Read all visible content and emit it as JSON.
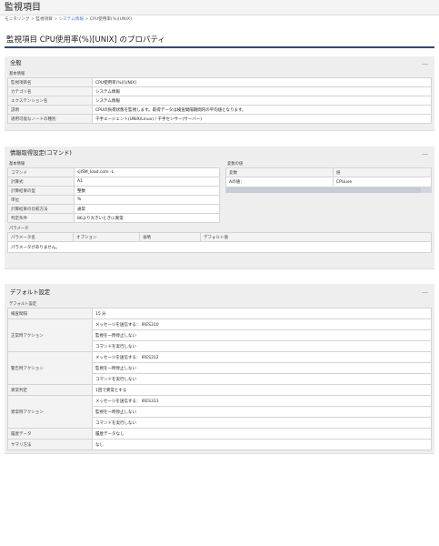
{
  "app": {
    "title": "監視項目"
  },
  "breadcrumb": {
    "item1": "モニタリング",
    "item2": "監視項目",
    "item3": "システム情報",
    "item4": "CPU使用率(%)[UNIX]",
    "sep": ">"
  },
  "page_title": "監視項目 CPU使用率(%)[UNIX] のプロパティ",
  "general": {
    "title": "全般",
    "collapse": "—",
    "sub": "基本情報",
    "rows": [
      {
        "label": "監視項目名",
        "value": "CPU使用率(%)[UNIX]"
      },
      {
        "label": "カテゴリ名",
        "value": "システム情報"
      },
      {
        "label": "エクステンション名",
        "value": "システム情報"
      },
      {
        "label": "説明",
        "value": "CPUの負荷状態を監視します。取得データは検査間隔期間内の平均値となります。"
      },
      {
        "label": "適用可能なノードの種別",
        "value": "千手エージェント(UNIX/Linux) / 千手センサー(サーバー)"
      }
    ]
  },
  "command": {
    "title": "情報取得設定(コマンド)",
    "collapse": "—",
    "sub": "基本情報",
    "rows": [
      {
        "label": "コマンド",
        "value": "sjISM_load.com -L"
      },
      {
        "label": "計算式",
        "value": "A1"
      },
      {
        "label": "計算結果の型",
        "value": "整数"
      },
      {
        "label": "単位",
        "value": "%"
      },
      {
        "label": "計算結果の比較方法",
        "value": "通常"
      },
      {
        "label": "判定条件",
        "value": "86より大きいときに異常"
      }
    ],
    "var_sub": "変数の値",
    "var_headers": {
      "name": "変数",
      "value": "値"
    },
    "var_rows": [
      {
        "name": "Aの値：",
        "value": "CPUuse"
      }
    ],
    "param_sub": "パラメータ",
    "param_headers": {
      "name": "パラメータ名",
      "option": "オプション",
      "omit": "省略",
      "default": "デフォルト値"
    },
    "param_empty": "パラメータがありません。"
  },
  "defaults": {
    "title": "デフォルト設定",
    "collapse": "—",
    "sub": "デフォルト設定",
    "interval": {
      "label": "検査間隔",
      "value": "15 分"
    },
    "normal": {
      "label": "正常時アクション",
      "v1": "メッセージを送信する： IRES310",
      "v2": "監視を一時停止しない",
      "v3": "コマンドを実行しない"
    },
    "warning": {
      "label": "警告時アクション",
      "v1": "メッセージを送信する： IRES312",
      "v2": "監視を一時停止しない",
      "v3": "コマンドを実行しない"
    },
    "abnormal_judge": {
      "label": "異常判定",
      "value": "1回で異常とする"
    },
    "abnormal": {
      "label": "異常時アクション",
      "v1": "メッセージを送信する： IRES311",
      "v2": "監視を一時停止しない",
      "v3": "コマンドを実行しない"
    },
    "history": {
      "label": "履歴データ",
      "value": "履歴データなし"
    },
    "summary": {
      "label": "サマリ方法",
      "value": "なし"
    }
  }
}
